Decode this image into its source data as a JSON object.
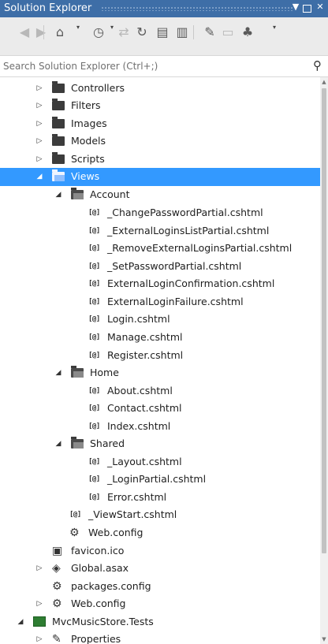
{
  "window": {
    "title": "Solution Explorer",
    "dropdown_glyph": "▼",
    "close_glyph": "✕"
  },
  "toolbar": {
    "items": [
      {
        "name": "back-icon",
        "glyph": "◀",
        "dim": true
      },
      {
        "name": "forward-icon",
        "glyph": "▶",
        "dim": true
      },
      {
        "name": "home-icon",
        "glyph": "⌂",
        "dim": false
      },
      {
        "name": "history-icon",
        "glyph": "◷",
        "dim": false
      },
      {
        "name": "sync-icon",
        "glyph": "⇄",
        "dim": true
      },
      {
        "name": "refresh-icon",
        "glyph": "↻",
        "dim": false
      },
      {
        "name": "collapse-all-icon",
        "glyph": "▤",
        "dim": false
      },
      {
        "name": "show-all-files-icon",
        "glyph": "▥",
        "dim": false
      },
      {
        "name": "properties-wrench-icon",
        "glyph": "✎",
        "dim": false
      },
      {
        "name": "preview-icon",
        "glyph": "▭",
        "dim": true
      },
      {
        "name": "class-diagram-icon",
        "glyph": "♣",
        "dim": false
      }
    ]
  },
  "search": {
    "placeholder": "Search Solution Explorer (Ctrl+;)",
    "value": ""
  },
  "tree": [
    {
      "label": "Controllers",
      "icon": "folder",
      "expander": "collapsed"
    },
    {
      "label": "Filters",
      "icon": "folder",
      "expander": "collapsed"
    },
    {
      "label": "Images",
      "icon": "folder",
      "expander": "collapsed"
    },
    {
      "label": "Models",
      "icon": "folder",
      "expander": "collapsed"
    },
    {
      "label": "Scripts",
      "icon": "folder",
      "expander": "collapsed"
    },
    {
      "label": "Views",
      "icon": "folder-open",
      "expander": "expanded",
      "selected": true
    },
    {
      "label": "Account",
      "icon": "folder-open",
      "expander": "expanded"
    },
    {
      "label": "_ChangePasswordPartial.cshtml",
      "icon": "razor"
    },
    {
      "label": "_ExternalLoginsListPartial.cshtml",
      "icon": "razor"
    },
    {
      "label": "_RemoveExternalLoginsPartial.cshtml",
      "icon": "razor"
    },
    {
      "label": "_SetPasswordPartial.cshtml",
      "icon": "razor"
    },
    {
      "label": "ExternalLoginConfirmation.cshtml",
      "icon": "razor"
    },
    {
      "label": "ExternalLoginFailure.cshtml",
      "icon": "razor"
    },
    {
      "label": "Login.cshtml",
      "icon": "razor"
    },
    {
      "label": "Manage.cshtml",
      "icon": "razor"
    },
    {
      "label": "Register.cshtml",
      "icon": "razor"
    },
    {
      "label": "Home",
      "icon": "folder-open",
      "expander": "expanded"
    },
    {
      "label": "About.cshtml",
      "icon": "razor"
    },
    {
      "label": "Contact.cshtml",
      "icon": "razor"
    },
    {
      "label": "Index.cshtml",
      "icon": "razor"
    },
    {
      "label": "Shared",
      "icon": "folder-open",
      "expander": "expanded"
    },
    {
      "label": "_Layout.cshtml",
      "icon": "razor"
    },
    {
      "label": "_LoginPartial.cshtml",
      "icon": "razor"
    },
    {
      "label": "Error.cshtml",
      "icon": "razor"
    },
    {
      "label": "_ViewStart.cshtml",
      "icon": "razor"
    },
    {
      "label": "Web.config",
      "icon": "config"
    },
    {
      "label": "favicon.ico",
      "icon": "favicon"
    },
    {
      "label": "Global.asax",
      "icon": "global",
      "expander": "collapsed"
    },
    {
      "label": "packages.config",
      "icon": "config"
    },
    {
      "label": "Web.config",
      "icon": "config",
      "expander": "collapsed"
    },
    {
      "label": "MvcMusicStore.Tests",
      "icon": "test-project",
      "expander": "expanded"
    },
    {
      "label": "Properties",
      "icon": "wrench",
      "expander": "collapsed"
    }
  ],
  "colors": {
    "title_bar": "#3e6ea7",
    "selection": "#3399ff",
    "tree_background": "#ffffff"
  }
}
